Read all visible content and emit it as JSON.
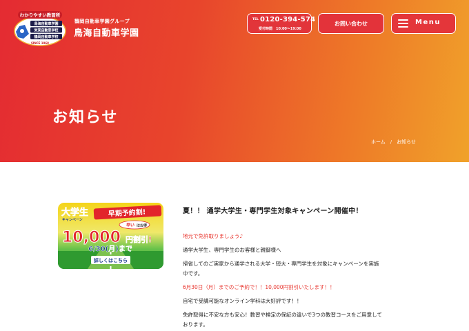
{
  "header": {
    "logo_badge_text": "わかりやすい教習所",
    "logo_school_1": "鳥海自動車学園",
    "logo_school_2": "栄東自動車学校",
    "logo_school_3": "鶴岡自動車学校",
    "logo_since": "SINCE 1968",
    "brand_sub": "鶴岡自動車学園グループ",
    "brand_main": "鳥海自動車学園",
    "tel_label": "TEL",
    "tel_number": "0120-394-574",
    "tel_hours": "受付時間　10:00〜19:00",
    "contact_label": "お問い合わせ",
    "menu_label": "Menu"
  },
  "hero": {
    "page_title": "お知らせ",
    "breadcrumb": [
      "ホーム",
      "お知らせ"
    ],
    "breadcrumb_sep": "/"
  },
  "banner": {
    "line1": "大学生",
    "line1_sub": "キャンペーン",
    "badge": "早期予約割!",
    "tag": "早い",
    "tag_sub": "はお得",
    "amount": "10,000",
    "amount_unit": "円割引!",
    "date": "6/30(月)まで",
    "cta": "詳しくはこちら"
  },
  "article": {
    "title": "夏！！ 通学大学生・専門学生対象キャンペーン開催中！",
    "paragraphs": [
      {
        "text": "地元で免許取りましょう♪",
        "red": true
      },
      {
        "text": "通学大学生、専門学生のお客様と親御様へ",
        "red": false
      },
      {
        "text": "帰省してのご実家から通学される大学・短大・専門学生を対象にキャンペーンを実施",
        "red": false
      },
      {
        "text": "中です。",
        "red": false
      },
      {
        "text": "6月30日（月）までのご予約で！！10,000円割引いたします！！",
        "red": true
      },
      {
        "text": "自宅で受講可能なオンライン学科は大好評です！！",
        "red": false
      },
      {
        "text": "免許取得に不安な方も安心！教習や検定の保証の違いで3つの教習コースをご用意して",
        "red": false
      },
      {
        "text": "おります。",
        "red": false
      }
    ]
  },
  "colors": {
    "hero_start": "#e42b32",
    "hero_end": "#f0a22a",
    "accent_red": "#e8342d"
  }
}
